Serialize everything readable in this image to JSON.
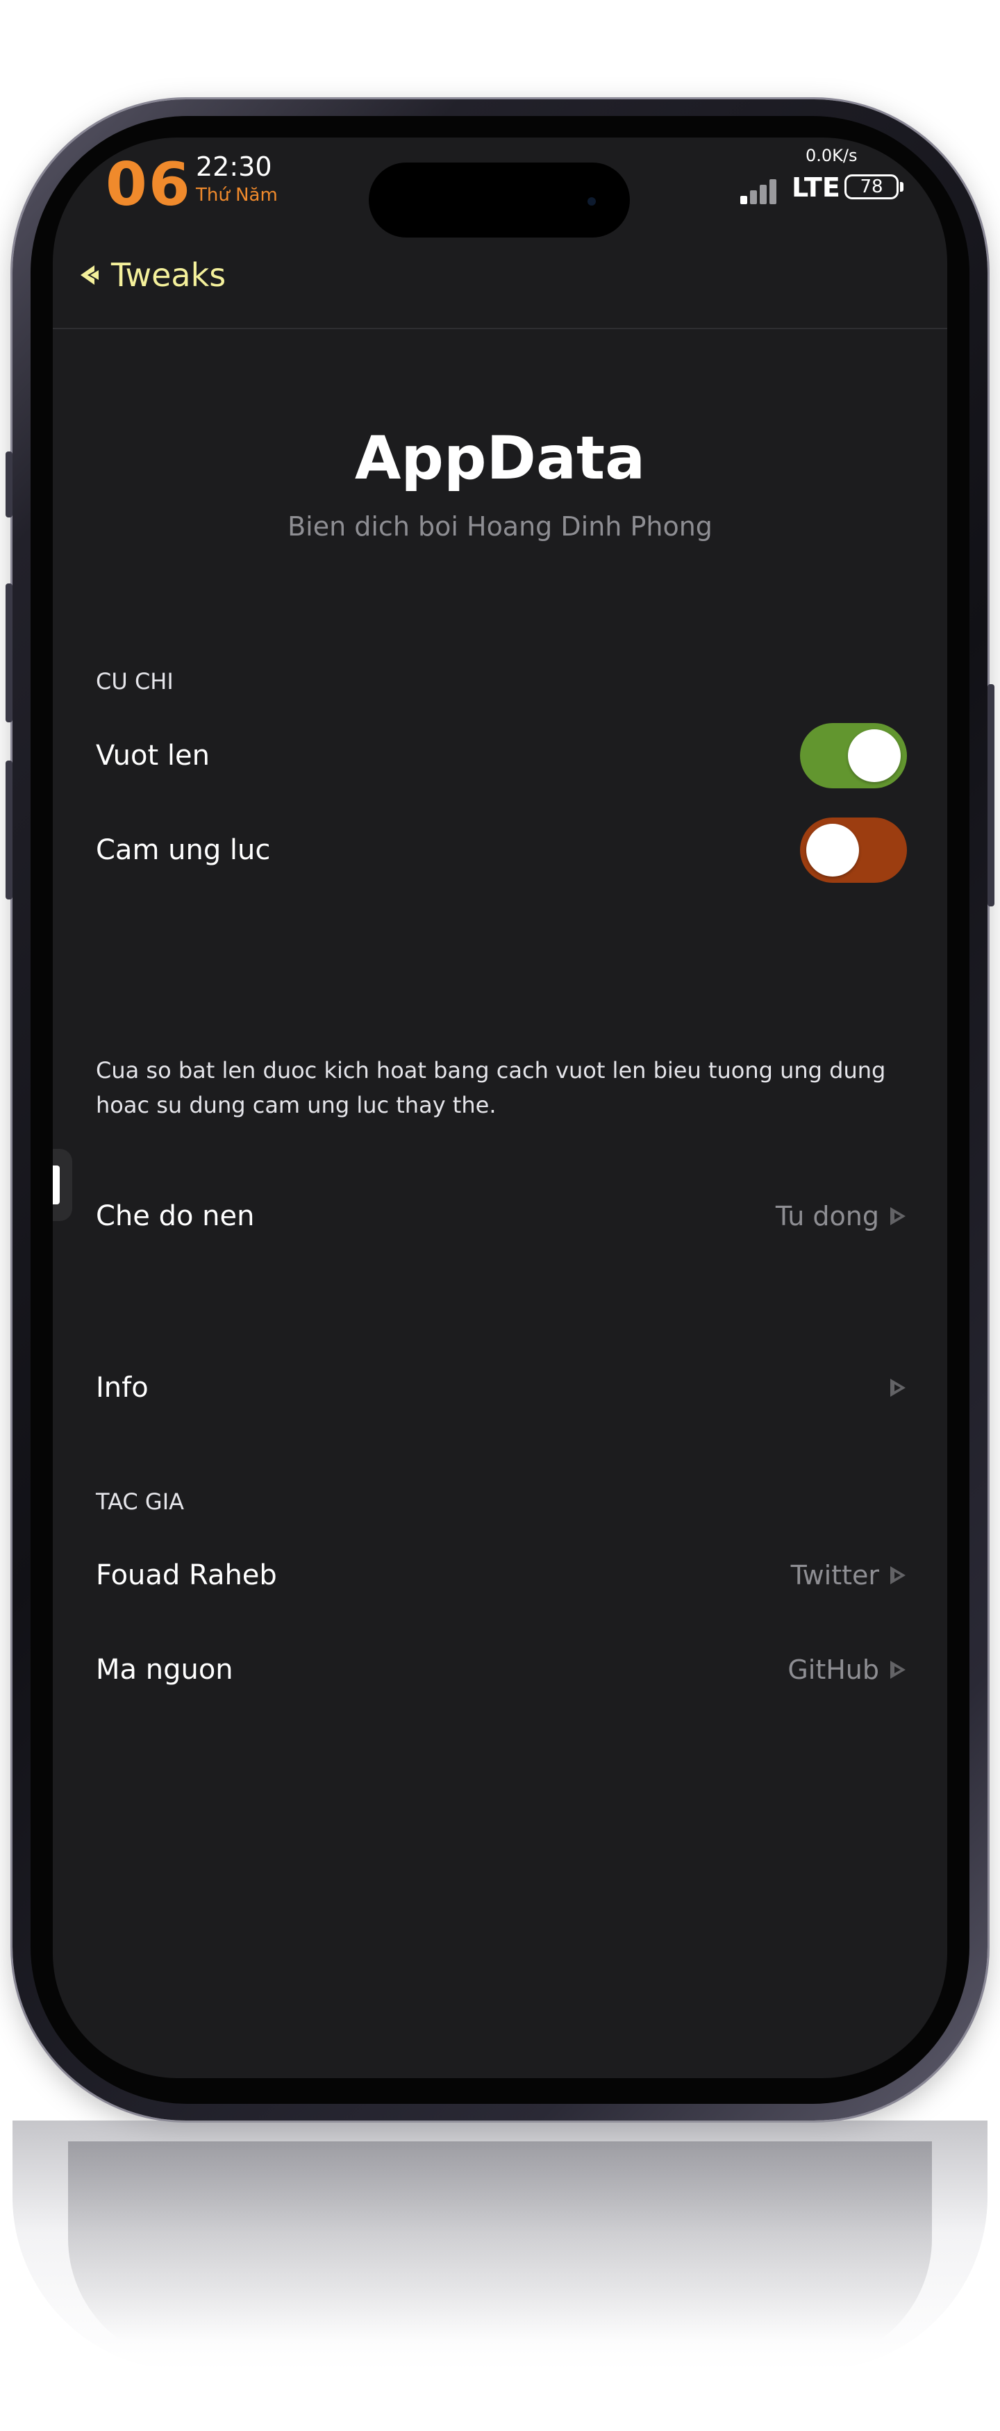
{
  "status_bar": {
    "date_number": "06",
    "time": "22:30",
    "weekday": "Thứ Năm",
    "net_speed": "0.0K/s",
    "network": "LTE",
    "battery": "78"
  },
  "nav": {
    "back_label": "Tweaks"
  },
  "header": {
    "title": "AppData",
    "subtitle": "Bien dich boi Hoang Dinh Phong"
  },
  "gestures": {
    "section_title": "CU CHI",
    "rows": [
      {
        "label": "Vuot len",
        "on": true
      },
      {
        "label": "Cam ung luc",
        "on": false
      }
    ],
    "footer": "Cua so bat len duoc kich hoat bang cach vuot len bieu tuong ung dung hoac su dung cam ung luc thay the."
  },
  "appearance": {
    "label": "Che do nen",
    "value": "Tu dong"
  },
  "info": {
    "label": "Info"
  },
  "author": {
    "section_title": "TAC GIA",
    "rows": [
      {
        "label": "Fouad Raheb",
        "value": "Twitter"
      },
      {
        "label": "Ma nguon",
        "value": "GitHub"
      }
    ]
  },
  "colors": {
    "toggle_on": "#62962f",
    "toggle_off": "#9c3d10",
    "accent_nav": "#f4f09b",
    "status_orange": "#f08a2c"
  }
}
